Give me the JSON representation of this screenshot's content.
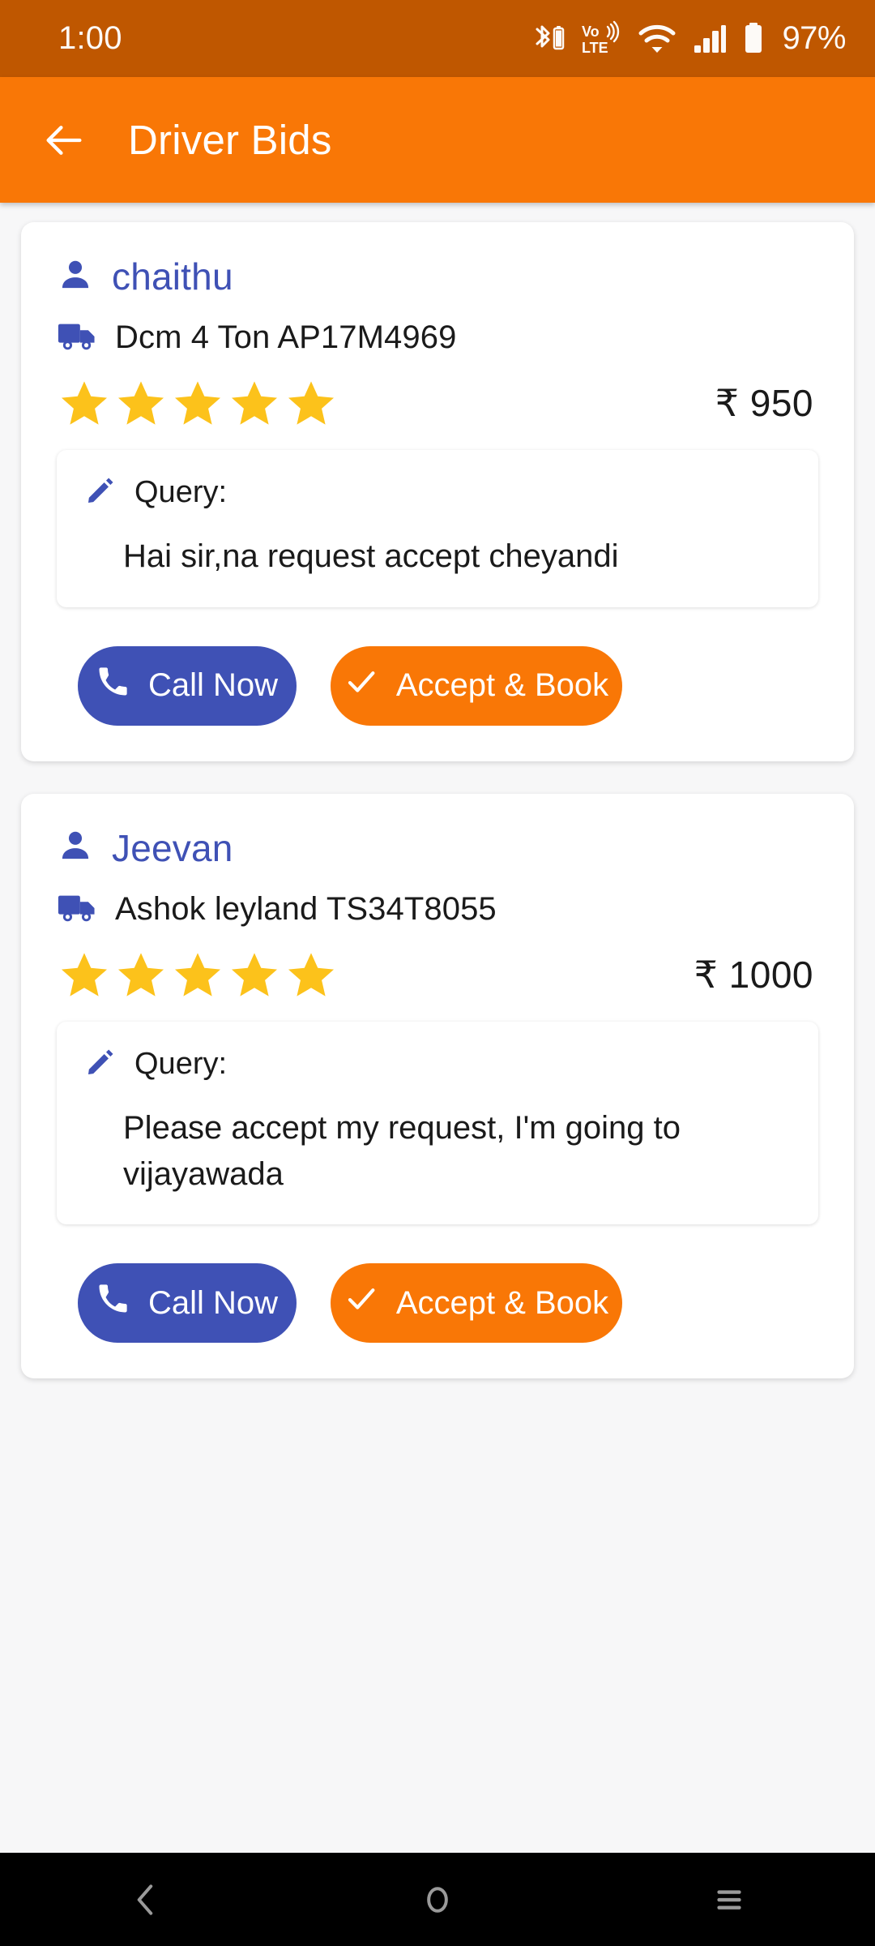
{
  "status_bar": {
    "time": "1:00",
    "battery_percent": "97%",
    "volte_top": "Vo",
    "volte_bottom": "LTE",
    "icons": [
      "bluetooth-battery-icon",
      "volte-icon",
      "wifi-icon",
      "signal-icon",
      "battery-icon"
    ],
    "background_color": "#bf5700"
  },
  "app_bar": {
    "title": "Driver Bids",
    "back_icon": "back-arrow-icon",
    "background_color": "#f97706",
    "text_color": "#ffffff"
  },
  "theme": {
    "accent_orange": "#f97706",
    "accent_blue": "#3f51b5",
    "star_gold": "#fcc21b",
    "page_background": "#f7f7f8",
    "card_background": "#ffffff"
  },
  "bids": [
    {
      "driver_name": "chaithu",
      "vehicle": "Dcm 4 Ton AP17M4969",
      "rating": 5,
      "price": "₹ 950",
      "query_label": "Query:",
      "query_text": "Hai sir,na request accept cheyandi",
      "call_button": "Call Now",
      "accept_button": "Accept & Book"
    },
    {
      "driver_name": "Jeevan",
      "vehicle": "Ashok leyland TS34T8055",
      "rating": 5,
      "price": "₹ 1000",
      "query_label": "Query:",
      "query_text": "Please accept my request, I'm going to vijayawada",
      "call_button": "Call Now",
      "accept_button": "Accept & Book"
    }
  ],
  "nav_bar": {
    "back_label": "back-nav-icon",
    "home_label": "home-nav-icon",
    "recents_label": "recents-nav-icon",
    "background_color": "#000000"
  }
}
